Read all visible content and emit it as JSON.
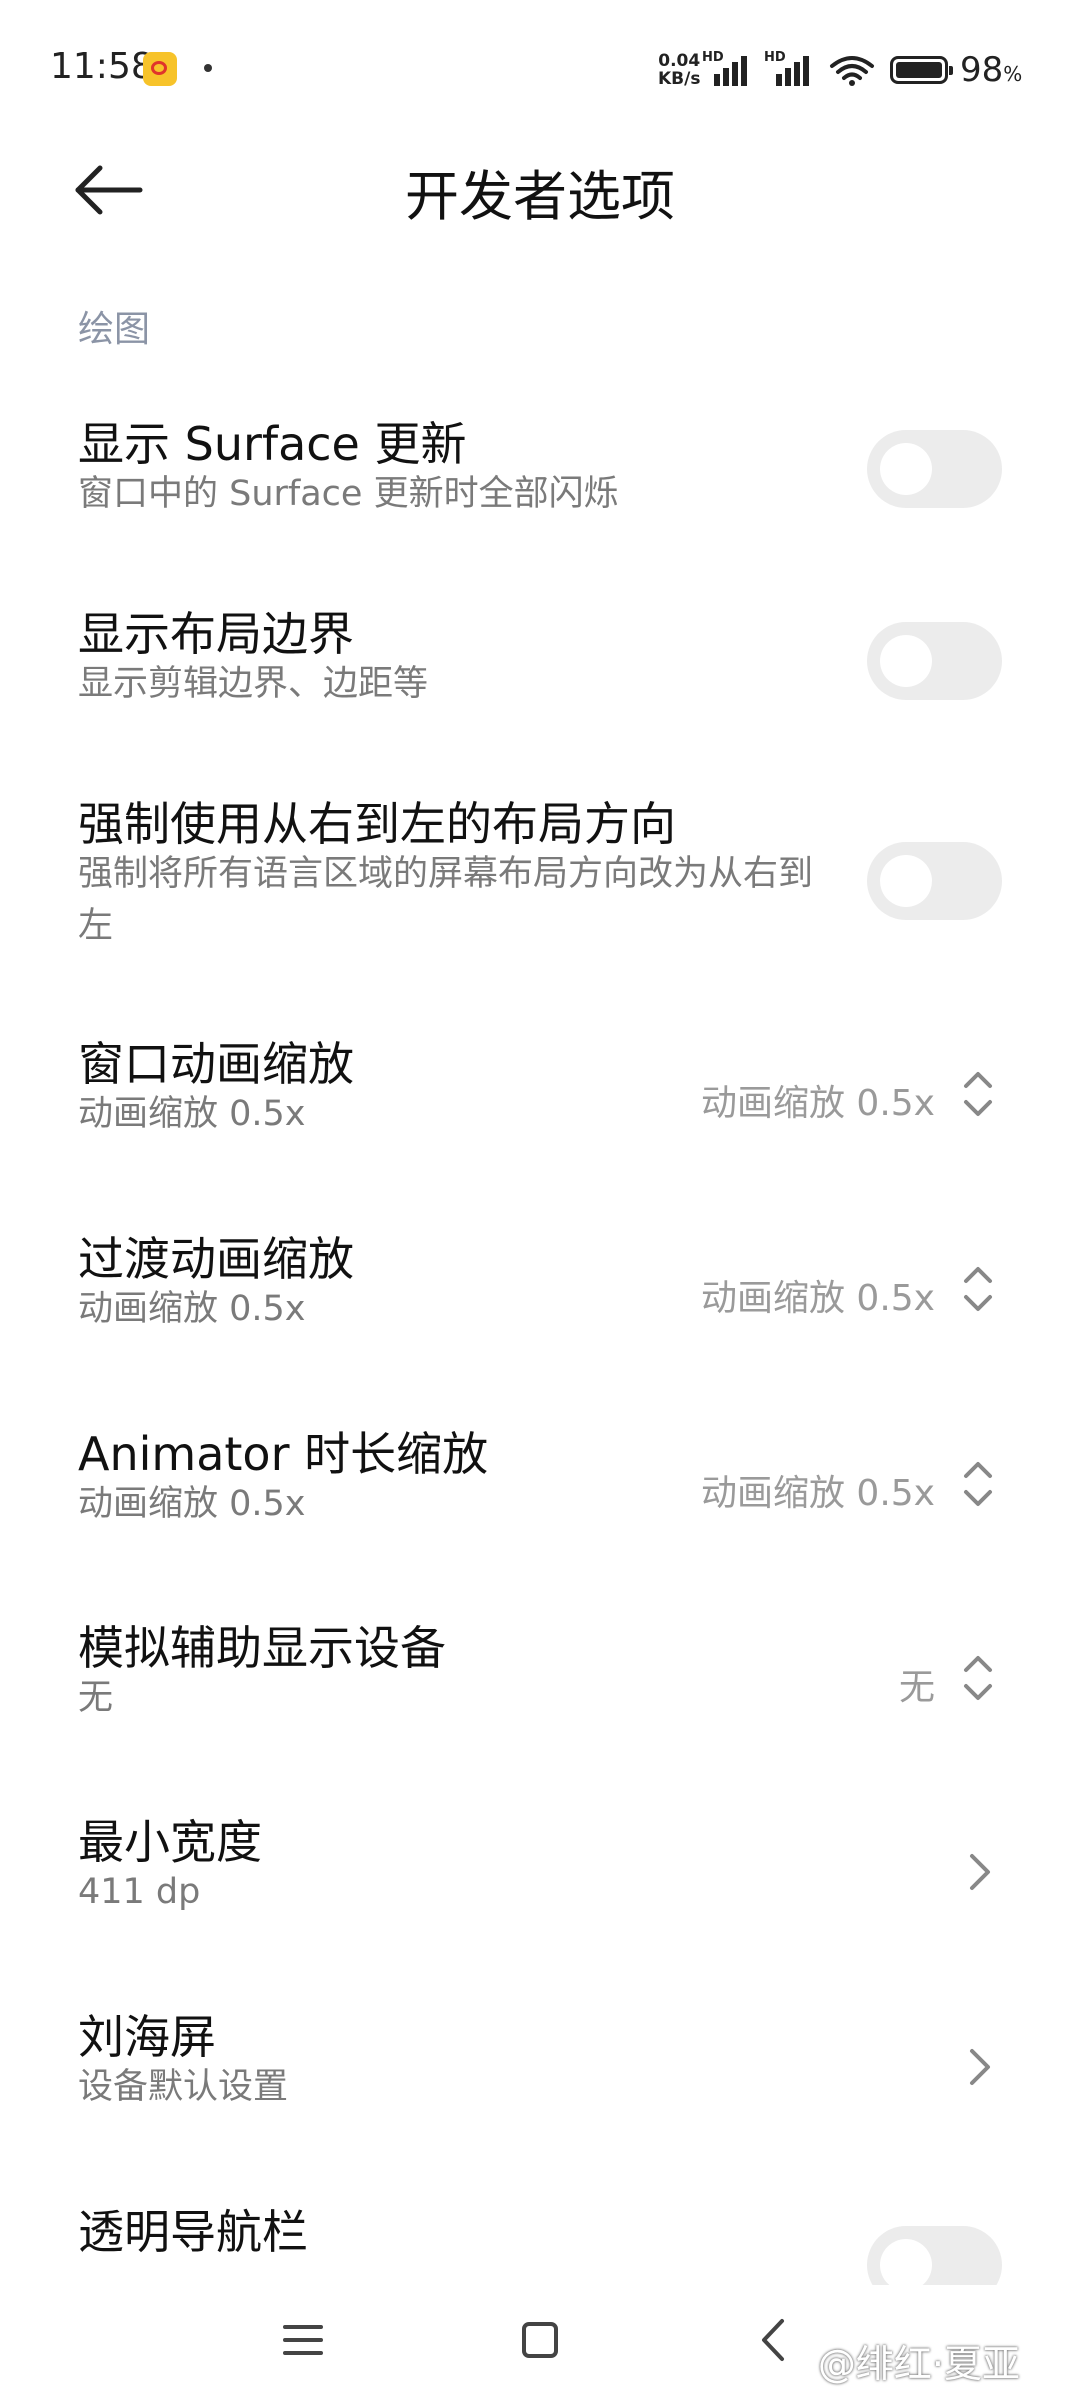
{
  "status_bar": {
    "time": "11:58",
    "net_speed_value": "0.04",
    "net_speed_unit": "KB/s",
    "signal_tag": "HD",
    "battery_percent": "98",
    "battery_suffix": "%",
    "icons": [
      "weibo-app-icon",
      "signal-icon",
      "wifi-icon",
      "battery-icon"
    ]
  },
  "header": {
    "title": "开发者选项",
    "back_icon": "arrow-left-icon"
  },
  "section": {
    "label": "绘图"
  },
  "rows": [
    {
      "title": "显示 Surface 更新",
      "subtitle": "窗口中的 Surface 更新时全部闪烁",
      "control": "toggle",
      "on": false
    },
    {
      "title": "显示布局边界",
      "subtitle": "显示剪辑边界、边距等",
      "control": "toggle",
      "on": false
    },
    {
      "title": "强制使用从右到左的布局方向",
      "subtitle": "强制将所有语言区域的屏幕布局方向改为从右到左",
      "control": "toggle",
      "on": false
    },
    {
      "title": "窗口动画缩放",
      "subtitle": "动画缩放 0.5x",
      "control": "dropdown",
      "value": "动画缩放 0.5x"
    },
    {
      "title": "过渡动画缩放",
      "subtitle": "动画缩放 0.5x",
      "control": "dropdown",
      "value": "动画缩放 0.5x"
    },
    {
      "title": "Animator 时长缩放",
      "subtitle": "动画缩放 0.5x",
      "control": "dropdown",
      "value": "动画缩放 0.5x"
    },
    {
      "title": "模拟辅助显示设备",
      "subtitle": "无",
      "control": "dropdown",
      "value": "无"
    },
    {
      "title": "最小宽度",
      "subtitle": "411 dp",
      "control": "chevron"
    },
    {
      "title": "刘海屏",
      "subtitle": "设备默认设置",
      "control": "chevron"
    },
    {
      "title": "透明导航栏",
      "control": "toggle",
      "on": false
    }
  ],
  "nav_bar": {
    "icons": [
      "menu-icon",
      "home-icon",
      "back-icon"
    ],
    "watermark": "@绯红·夏亚"
  },
  "colors": {
    "toggle_off": "#ececec",
    "section_label": "#8b94a6",
    "subtitle": "#7a7a7a",
    "value": "#9a9a9a"
  }
}
